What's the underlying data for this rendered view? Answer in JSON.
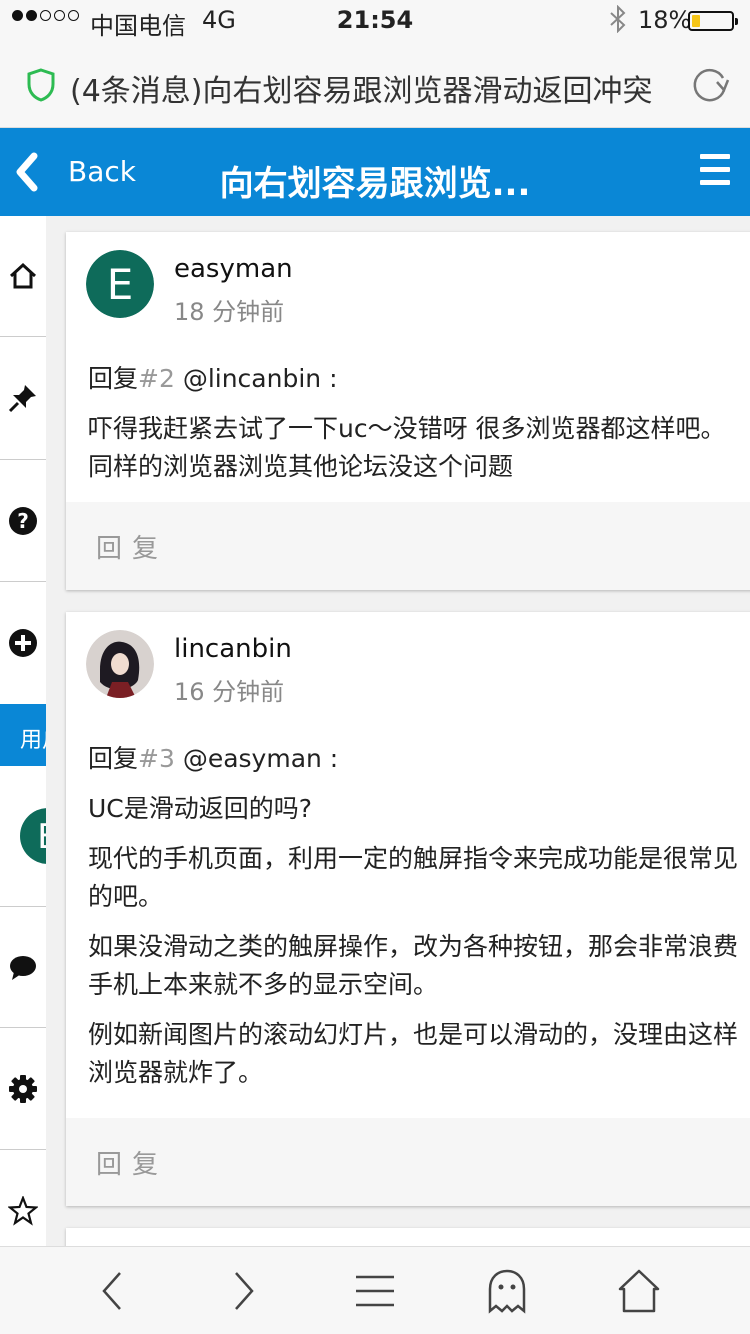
{
  "status_bar": {
    "carrier": "中国电信",
    "network": "4G",
    "time": "21:54",
    "battery_percent": "18%",
    "battery_level": 0.18,
    "signal_bars": 2
  },
  "address_bar": {
    "page_title": "(4条消息)向右划容易跟浏览器滑动返回冲突"
  },
  "header": {
    "back_label": "Back",
    "title": "向右划容易跟浏览..."
  },
  "rail": {
    "icons": [
      "home-icon",
      "pin-icon",
      "question-icon",
      "plus-circle-icon",
      "avatar",
      "chat-bubble-icon",
      "gear-icon",
      "star-icon"
    ],
    "active_label": "用户"
  },
  "posts": [
    {
      "author": "easyman",
      "time": "18 分钟前",
      "reply_prefix": "回复",
      "reply_num": "#2",
      "reply_to": " @lincanbin :",
      "paragraphs": [
        "吓得我赶紧去试了一下uc～没错呀 很多浏览器都这样吧。同样的浏览器浏览其他论坛没这个问题"
      ],
      "reply_button": "回复"
    },
    {
      "author": "lincanbin",
      "time": "16 分钟前",
      "reply_prefix": "回复",
      "reply_num": "#3",
      "reply_to": " @easyman :",
      "paragraphs": [
        "UC是滑动返回的吗?",
        "现代的手机页面，利用一定的触屏指令来完成功能是很常见的吧。",
        "如果没滑动之类的触屏操作，改为各种按钮，那会非常浪费手机上本来就不多的显示空间。",
        "例如新闻图片的滚动幻灯片，也是可以滑动的，没理由这样浏览器就炸了。"
      ],
      "reply_button": "回复"
    }
  ],
  "colors": {
    "accent": "#0a87d6",
    "avatar_easyman": "#0e6b5a",
    "shield": "#2dbb52"
  },
  "toolbar": {
    "icons": [
      "back-arrow-icon",
      "forward-arrow-icon",
      "menu-lines-icon",
      "ghost-icon",
      "home-outline-icon"
    ]
  }
}
